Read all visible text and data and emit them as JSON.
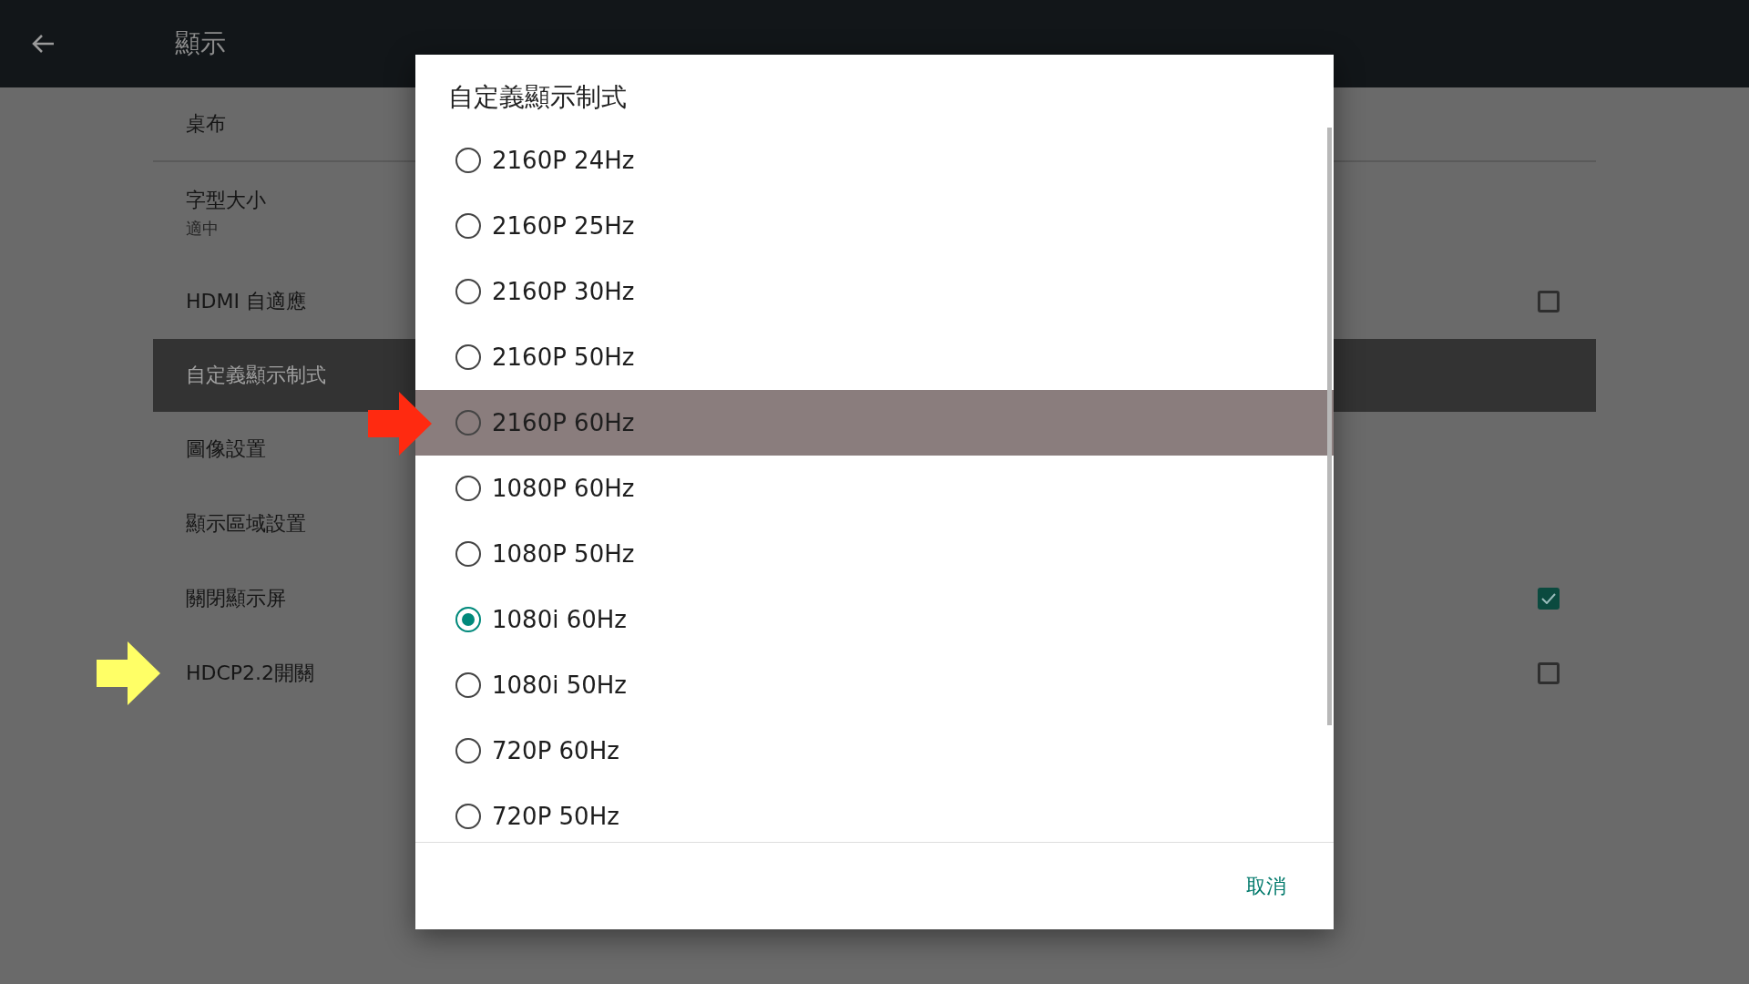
{
  "top_bar": {
    "title": "顯示"
  },
  "settings": [
    {
      "label": "桌布",
      "kind": "plain",
      "selected": false
    },
    {
      "label": "字型大小",
      "subtitle": "適中",
      "kind": "plain",
      "selected": false
    },
    {
      "label": "HDMI 自適應",
      "kind": "checkbox",
      "checked": false,
      "selected": false
    },
    {
      "label": "自定義顯示制式",
      "kind": "plain",
      "selected": true
    },
    {
      "label": "圖像設置",
      "kind": "plain",
      "selected": false
    },
    {
      "label": "顯示區域設置",
      "kind": "plain",
      "selected": false
    },
    {
      "label": "關閉顯示屏",
      "kind": "checkbox",
      "checked": true,
      "selected": false
    },
    {
      "label": "HDCP2.2開關",
      "kind": "checkbox",
      "checked": false,
      "selected": false,
      "arrow": {
        "color": "#ffff66"
      }
    }
  ],
  "dialog": {
    "title": "自定義顯示制式",
    "options": [
      {
        "label": "2160P 24Hz",
        "checked": false,
        "focused": false
      },
      {
        "label": "2160P 25Hz",
        "checked": false,
        "focused": false
      },
      {
        "label": "2160P 30Hz",
        "checked": false,
        "focused": false
      },
      {
        "label": "2160P 50Hz",
        "checked": false,
        "focused": false
      },
      {
        "label": "2160P 60Hz",
        "checked": false,
        "focused": true,
        "arrow": {
          "color": "#ff2a10"
        }
      },
      {
        "label": "1080P 60Hz",
        "checked": false,
        "focused": false
      },
      {
        "label": "1080P 50Hz",
        "checked": false,
        "focused": false
      },
      {
        "label": "1080i 60Hz",
        "checked": true,
        "focused": false
      },
      {
        "label": "1080i 50Hz",
        "checked": false,
        "focused": false
      },
      {
        "label": "720P 60Hz",
        "checked": false,
        "focused": false
      },
      {
        "label": "720P 50Hz",
        "checked": false,
        "focused": false
      }
    ],
    "cancel_button": "取消"
  }
}
